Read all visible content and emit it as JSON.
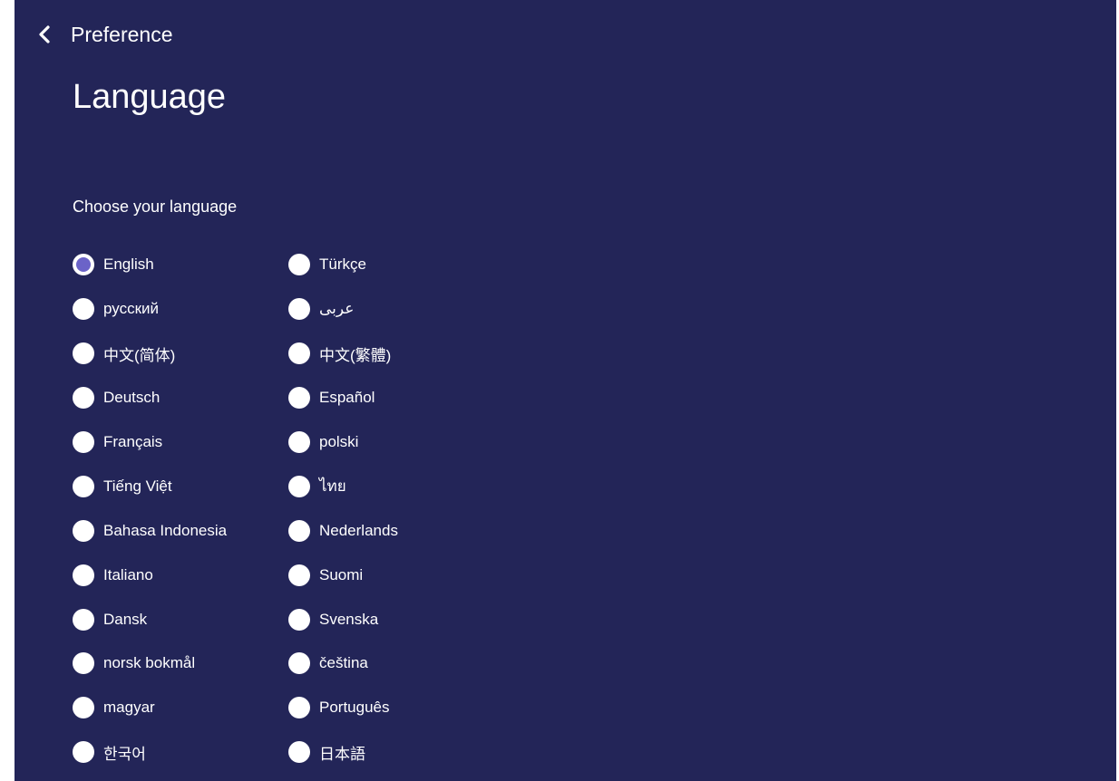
{
  "header": {
    "back_label": "Preference",
    "title": "Language"
  },
  "section": {
    "label": "Choose your language"
  },
  "colors": {
    "background": "#232558",
    "accent": "#6b63c8",
    "text": "#ffffff"
  },
  "languages": [
    {
      "label": "English",
      "selected": true
    },
    {
      "label": "Türkçe",
      "selected": false
    },
    {
      "label": "русский",
      "selected": false
    },
    {
      "label": "عربى",
      "selected": false
    },
    {
      "label": "中文(简体)",
      "selected": false
    },
    {
      "label": "中文(繁體)",
      "selected": false
    },
    {
      "label": "Deutsch",
      "selected": false
    },
    {
      "label": "Español",
      "selected": false
    },
    {
      "label": "Français",
      "selected": false
    },
    {
      "label": "polski",
      "selected": false
    },
    {
      "label": "Tiếng Việt",
      "selected": false
    },
    {
      "label": "ไทย",
      "selected": false
    },
    {
      "label": "Bahasa Indonesia",
      "selected": false
    },
    {
      "label": "Nederlands",
      "selected": false
    },
    {
      "label": "Italiano",
      "selected": false
    },
    {
      "label": "Suomi",
      "selected": false
    },
    {
      "label": "Dansk",
      "selected": false
    },
    {
      "label": "Svenska",
      "selected": false
    },
    {
      "label": "norsk bokmål",
      "selected": false
    },
    {
      "label": "čeština",
      "selected": false
    },
    {
      "label": "magyar",
      "selected": false
    },
    {
      "label": "Português",
      "selected": false
    },
    {
      "label": "한국어",
      "selected": false
    },
    {
      "label": "日本語",
      "selected": false
    }
  ]
}
